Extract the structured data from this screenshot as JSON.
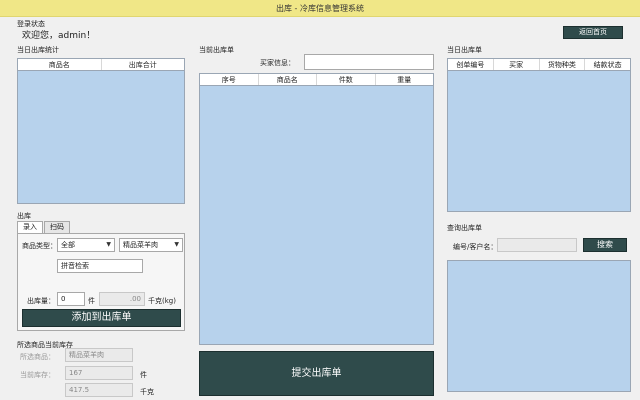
{
  "window": {
    "title": "出库 - 冷库信息管理系统"
  },
  "login": {
    "label": "登录状态",
    "welcome": "欢迎您，admin！"
  },
  "back_button": "返回首页",
  "stats": {
    "title": "当日出库统计",
    "columns": [
      "商品名",
      "出库合计"
    ]
  },
  "outbound": {
    "title": "出库",
    "tabs": [
      "录入",
      "扫码"
    ],
    "product_type_label": "商品类型：",
    "product_type_value": "全部",
    "product_value": "精品菜羊肉",
    "pinyin_placeholder": "拼音检索",
    "qty_label": "出库量：",
    "qty_value": "0",
    "qty_unit": "件",
    "weight_value": ".00",
    "weight_unit": "千克(kg)",
    "add_button": "添加到出库单"
  },
  "stock": {
    "title": "所选商品当前库存",
    "selected_label": "所选商品：",
    "selected_value": "精品菜羊肉",
    "stock_label": "当前库存：",
    "stock_count": "167",
    "stock_count_unit": "件",
    "stock_weight": "417.5",
    "stock_weight_unit": "千克"
  },
  "current_order": {
    "title": "当前出库单",
    "buyer_label": "买家信息：",
    "buyer_value": "",
    "columns": [
      "序号",
      "商品名",
      "件数",
      "重量"
    ],
    "submit_button": "提交出库单"
  },
  "today_orders": {
    "title": "当日出库单",
    "columns": [
      "创单编号",
      "买家",
      "货物种类",
      "结款状态"
    ]
  },
  "query": {
    "title": "查询出库单",
    "field_label": "编号/客户名：",
    "field_value": "",
    "search_button": "搜索"
  }
}
